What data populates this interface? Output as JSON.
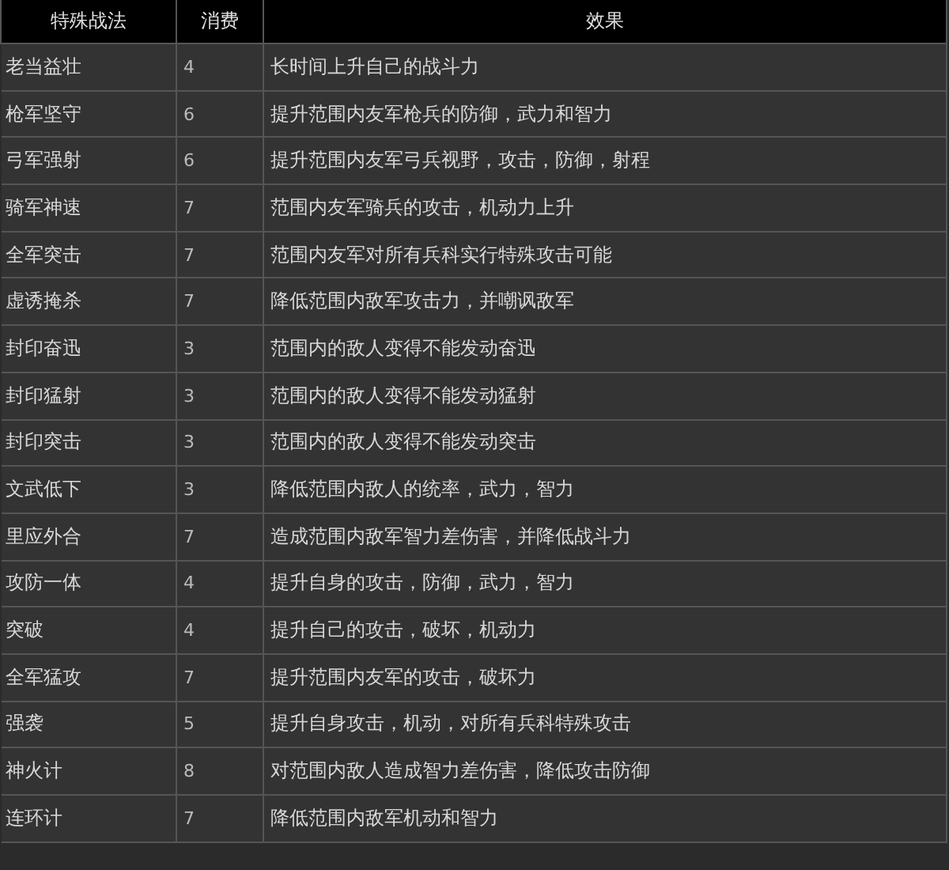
{
  "table": {
    "columns": [
      "特殊战法",
      "消费",
      "效果"
    ],
    "rows": [
      [
        "老当益壮",
        "4",
        "长时间上升自己的战斗力"
      ],
      [
        "枪军坚守",
        "6",
        "提升范围内友军枪兵的防御，武力和智力"
      ],
      [
        "弓军强射",
        "6",
        "提升范围内友军弓兵视野，攻击，防御，射程"
      ],
      [
        "骑军神速",
        "7",
        "范围内友军骑兵的攻击，机动力上升"
      ],
      [
        "全军突击",
        "7",
        "范围内友军对所有兵科实行特殊攻击可能"
      ],
      [
        "虚诱掩杀",
        "7",
        "降低范围内敌军攻击力，并嘲讽敌军"
      ],
      [
        "封印奋迅",
        "3",
        "范围内的敌人变得不能发动奋迅"
      ],
      [
        "封印猛射",
        "3",
        "范围内的敌人变得不能发动猛射"
      ],
      [
        "封印突击",
        "3",
        "范围内的敌人变得不能发动突击"
      ],
      [
        "文武低下",
        "3",
        "降低范围内敌人的统率，武力，智力"
      ],
      [
        "里应外合",
        "7",
        "造成范围内敌军智力差伤害，并降低战斗力"
      ],
      [
        "攻防一体",
        "4",
        "提升自身的攻击，防御，武力，智力"
      ],
      [
        "突破",
        "4",
        "提升自己的攻击，破坏，机动力"
      ],
      [
        "全军猛攻",
        "7",
        "提升范围内友军的攻击，破坏力"
      ],
      [
        "强袭",
        "5",
        "提升自身攻击，机动，对所有兵科特殊攻击"
      ],
      [
        "神火计",
        "8",
        "对范围内敌人造成智力差伤害，降低攻击防御"
      ],
      [
        "连环计",
        "7",
        "降低范围内敌军机动和智力"
      ]
    ]
  }
}
